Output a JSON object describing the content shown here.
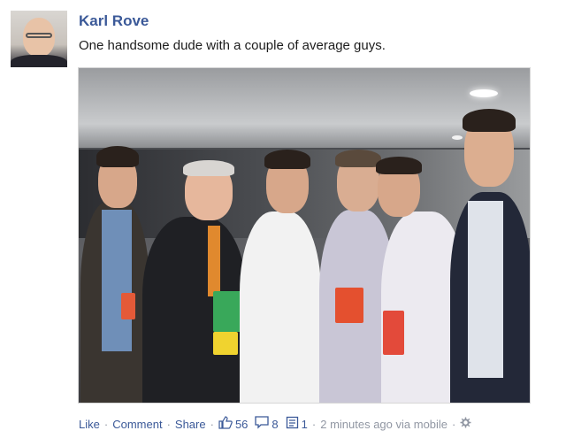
{
  "post": {
    "author": "Karl Rove",
    "message": "One handsome dude with a couple of average guys.",
    "photo_icon": "group-photo"
  },
  "actions": {
    "like": "Like",
    "comment": "Comment",
    "share": "Share",
    "likes_count": "56",
    "comments_count": "8",
    "shares_count": "1",
    "timestamp": "2 minutes ago via mobile",
    "separator": "·"
  }
}
